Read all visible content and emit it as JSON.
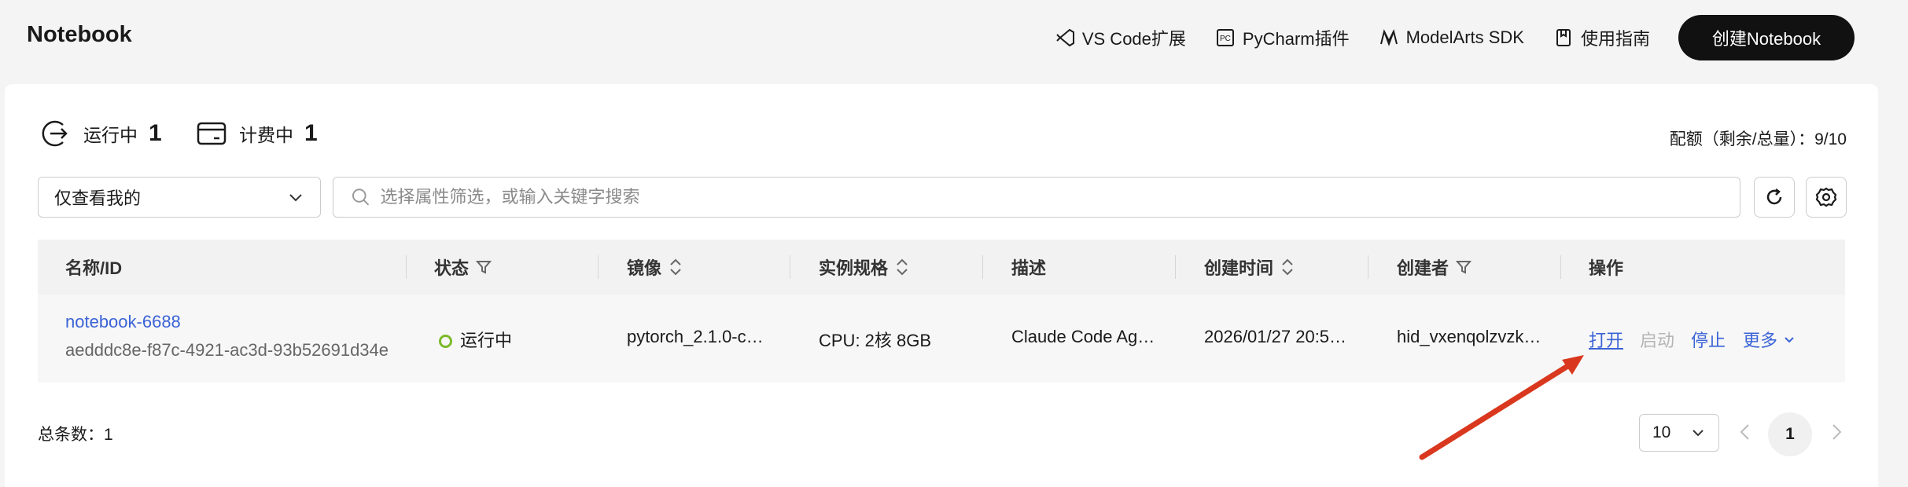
{
  "header": {
    "title": "Notebook",
    "links": {
      "vscode": "VS Code扩展",
      "pycharm": "PyCharm插件",
      "sdk": "ModelArts SDK",
      "guide": "使用指南"
    },
    "create_button": "创建Notebook"
  },
  "stats": {
    "running_label": "运行中",
    "running_count": "1",
    "billing_label": "计费中",
    "billing_count": "1",
    "quota": "配额（剩余/总量）：9/10"
  },
  "filters": {
    "scope_select": "仅查看我的",
    "search_placeholder": "选择属性筛选，或输入关键字搜索"
  },
  "table": {
    "columns": {
      "name": "名称/ID",
      "status": "状态",
      "image": "镜像",
      "spec": "实例规格",
      "desc": "描述",
      "created": "创建时间",
      "creator": "创建者",
      "actions": "操作"
    },
    "rows": [
      {
        "name": "notebook-6688",
        "id": "aedddc8e-f87c-4921-ac3d-93b52691d34e",
        "status": "运行中",
        "image": "pytorch_2.1.0-cu…",
        "spec": "CPU: 2核 8GB",
        "desc": "Claude Code Ag…",
        "created": "2026/01/27 20:5…",
        "creator": "hid_vxenqolzvzk…",
        "actions": {
          "open": "打开",
          "start": "启动",
          "stop": "停止",
          "more": "更多"
        }
      }
    ]
  },
  "footer": {
    "total": "总条数：1",
    "page_size": "10",
    "current_page": "1"
  },
  "colors": {
    "link": "#3a63d6",
    "running": "#7cba2c",
    "annotation_arrow": "#d9381e",
    "primary_button": "#111111"
  }
}
